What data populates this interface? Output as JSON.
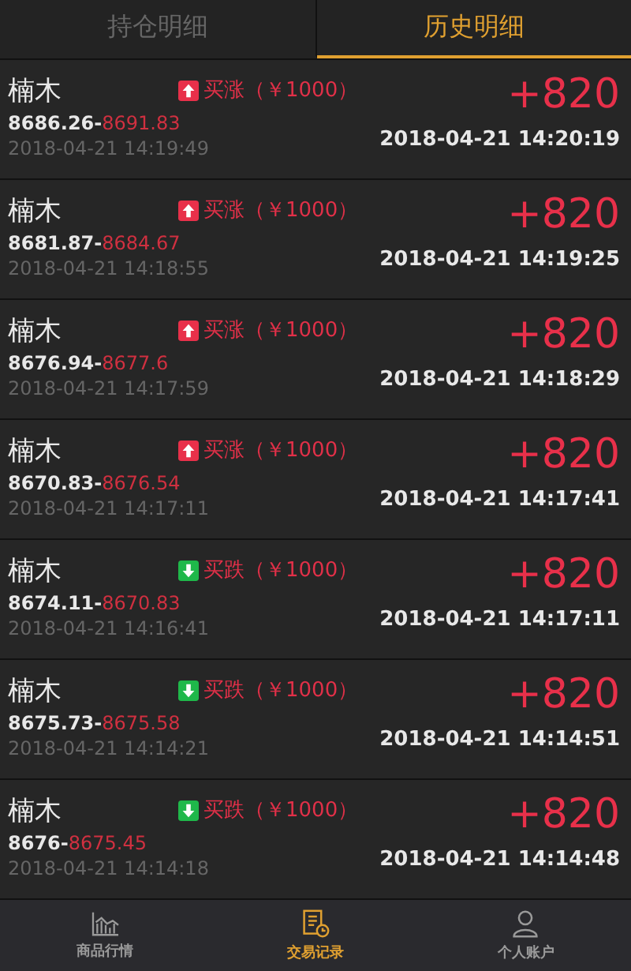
{
  "tabs": [
    {
      "label": "持仓明细",
      "selected": false
    },
    {
      "label": "历史明细",
      "selected": true
    }
  ],
  "trades": [
    {
      "name": "楠木",
      "kind": "up",
      "order": "买涨（￥1000）",
      "open_price": "8686.26-",
      "close_price": "8691.83",
      "open_time": "2018-04-21 14:19:49",
      "profit": "+820",
      "close_time": "2018-04-21 14:20:19"
    },
    {
      "name": "楠木",
      "kind": "up",
      "order": "买涨（￥1000）",
      "open_price": "8681.87-",
      "close_price": "8684.67",
      "open_time": "2018-04-21 14:18:55",
      "profit": "+820",
      "close_time": "2018-04-21 14:19:25"
    },
    {
      "name": "楠木",
      "kind": "up",
      "order": "买涨（￥1000）",
      "open_price": "8676.94-",
      "close_price": "8677.6",
      "open_time": "2018-04-21 14:17:59",
      "profit": "+820",
      "close_time": "2018-04-21 14:18:29"
    },
    {
      "name": "楠木",
      "kind": "up",
      "order": "买涨（￥1000）",
      "open_price": "8670.83-",
      "close_price": "8676.54",
      "open_time": "2018-04-21 14:17:11",
      "profit": "+820",
      "close_time": "2018-04-21 14:17:41"
    },
    {
      "name": "楠木",
      "kind": "down",
      "order": "买跌（￥1000）",
      "open_price": "8674.11-",
      "close_price": "8670.83",
      "open_time": "2018-04-21 14:16:41",
      "profit": "+820",
      "close_time": "2018-04-21 14:17:11"
    },
    {
      "name": "楠木",
      "kind": "down",
      "order": "买跌（￥1000）",
      "open_price": "8675.73-",
      "close_price": "8675.58",
      "open_time": "2018-04-21 14:14:21",
      "profit": "+820",
      "close_time": "2018-04-21 14:14:51"
    },
    {
      "name": "楠木",
      "kind": "down",
      "order": "买跌（￥1000）",
      "open_price": "8676-",
      "close_price": "8675.45",
      "open_time": "2018-04-21 14:14:18",
      "profit": "+820",
      "close_time": "2018-04-21 14:14:48"
    }
  ],
  "nav": [
    {
      "label": "商品行情",
      "selected": false
    },
    {
      "label": "交易记录",
      "selected": true
    },
    {
      "label": "个人账户",
      "selected": false
    }
  ]
}
